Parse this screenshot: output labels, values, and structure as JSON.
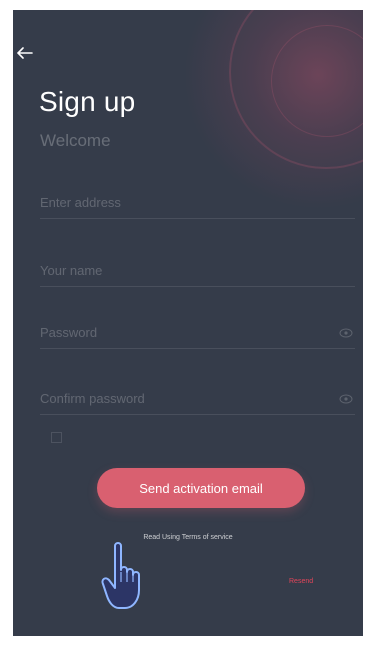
{
  "colors": {
    "background": "#353c4a",
    "accent": "#d96070",
    "link": "#e2455a"
  },
  "header": {
    "back_icon": "arrow-left-icon",
    "title": "Sign up",
    "subtitle": "Welcome"
  },
  "form": {
    "email_placeholder": "Enter address",
    "name_placeholder": "Your name",
    "password_placeholder": "Password",
    "confirm_placeholder": "Confirm password"
  },
  "actions": {
    "send_label": "Send activation email",
    "tos_note": "Read Using Terms of service"
  },
  "login": {
    "link": "Resend"
  },
  "cursor_icon": "hand-pointer-icon"
}
